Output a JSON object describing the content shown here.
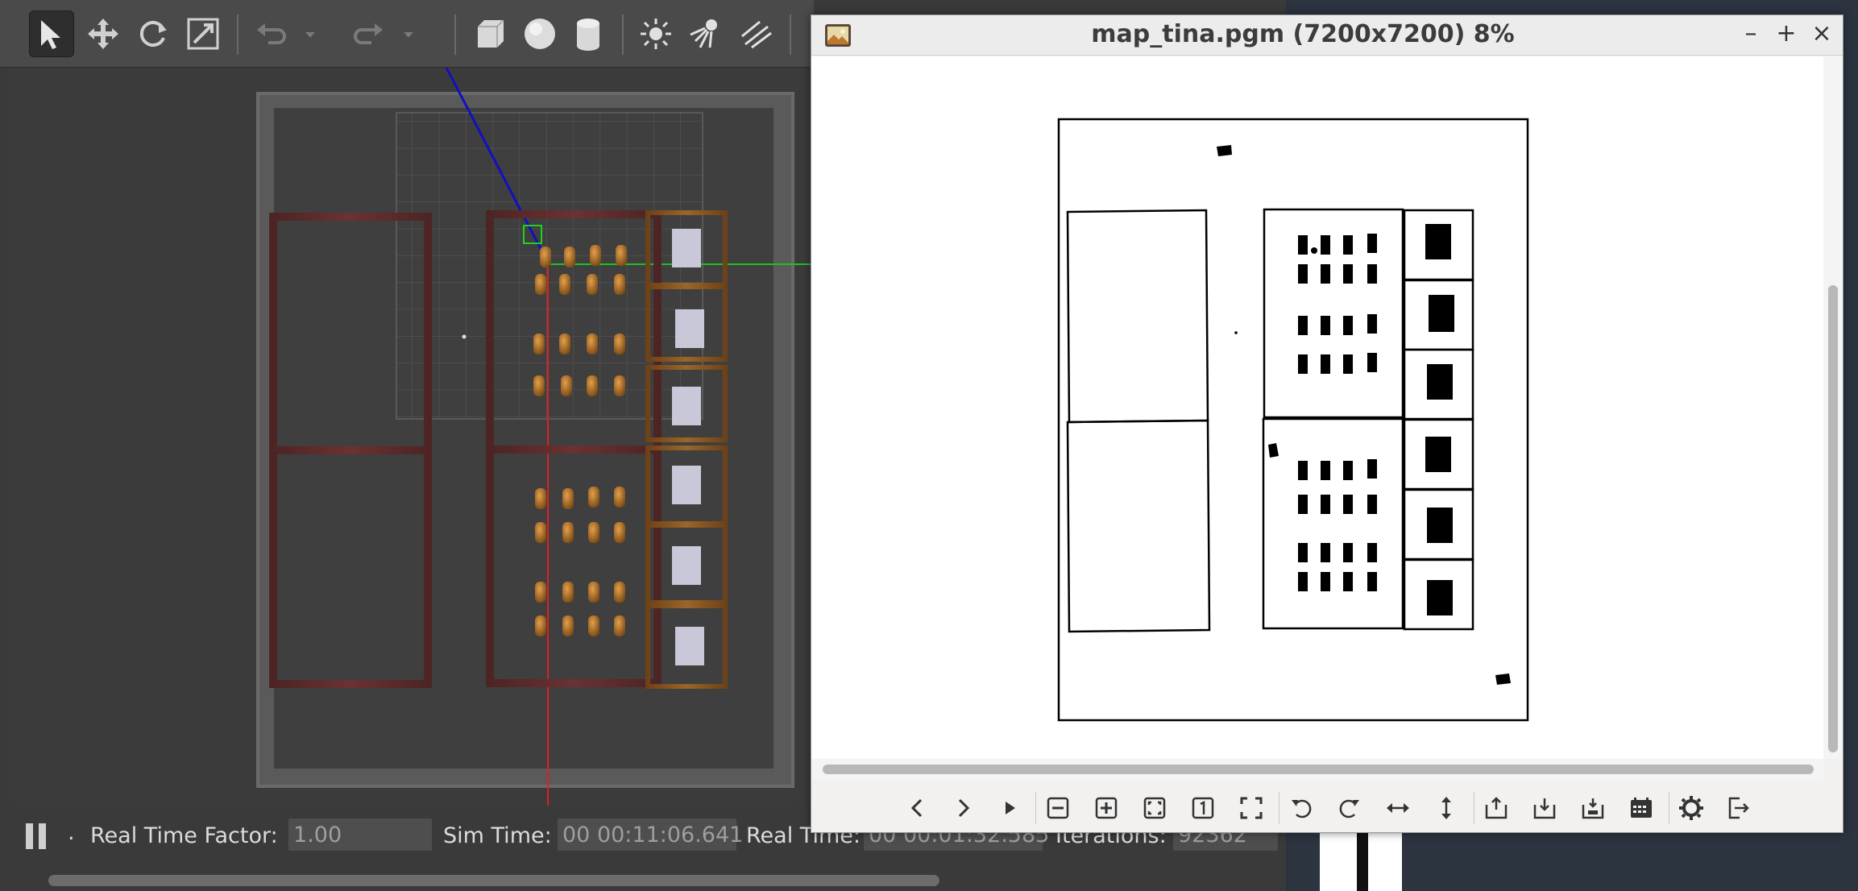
{
  "gazebo": {
    "toolbar": {
      "tools": [
        {
          "name": "select-mode-tool",
          "icon": "arrow-pointer-icon"
        },
        {
          "name": "translate-mode-tool",
          "icon": "move-arrows-icon"
        },
        {
          "name": "rotate-mode-tool",
          "icon": "rotate-icon"
        },
        {
          "name": "scale-mode-tool",
          "icon": "scale-icon"
        },
        {
          "name": "undo-tool",
          "icon": "undo-icon"
        },
        {
          "name": "redo-tool",
          "icon": "redo-icon"
        },
        {
          "name": "box-shape-tool",
          "icon": "box-icon"
        },
        {
          "name": "sphere-shape-tool",
          "icon": "sphere-icon"
        },
        {
          "name": "cylinder-shape-tool",
          "icon": "cylinder-icon"
        },
        {
          "name": "point-light-tool",
          "icon": "sun-icon"
        },
        {
          "name": "spot-light-tool",
          "icon": "spotlight-icon"
        },
        {
          "name": "directional-light-tool",
          "icon": "directional-light-icon"
        }
      ]
    },
    "status": {
      "real_time_factor_label": "Real Time Factor:",
      "real_time_factor_value": "1.00",
      "sim_time_label": "Sim Time:",
      "sim_time_value": "00 00:11:06.641",
      "real_time_label": "Real Time:",
      "real_time_value": "00 00:01:32.585",
      "iterations_label": "Iterations:",
      "iterations_value": "92362",
      "step_label": "."
    }
  },
  "viewer": {
    "title": "map_tina.pgm (7200x7200) 8%",
    "window_buttons": {
      "minimize": "–",
      "maximize": "+",
      "close": "×"
    },
    "toolbar_icons": [
      "previous-icon",
      "next-icon",
      "play-slideshow-icon",
      "zoom-out-icon",
      "zoom-in-icon",
      "fit-window-icon",
      "original-size-icon",
      "fullscreen-icon",
      "rotate-left-icon",
      "rotate-right-icon",
      "flip-horizontal-icon",
      "flip-vertical-icon",
      "open-icon",
      "save-icon",
      "save-as-icon",
      "print-icon",
      "preferences-icon",
      "exit-icon"
    ]
  },
  "colors": {
    "gazebo_bg": "#3b3b3b",
    "toolbar_bg": "#4a4a4a",
    "wood": "#5a2a2a",
    "wood_orange": "#8a5a25",
    "x_axis": "#e02020",
    "y_axis": "#20c020",
    "z_link": "#1010c0",
    "viewer_bg": "#ffffff",
    "map_line": "#000000"
  }
}
